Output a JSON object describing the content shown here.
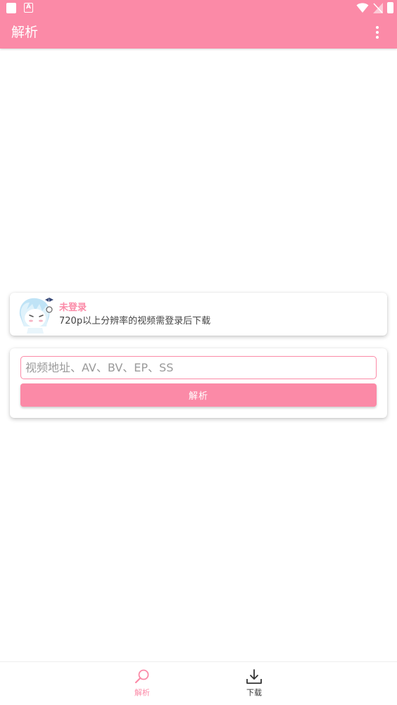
{
  "app": {
    "title": "解析",
    "accent_color": "#fb8aa7"
  },
  "status_bar": {
    "icons": [
      "sim-card-icon",
      "app-notification-icon",
      "wifi-icon",
      "signal-icon",
      "battery-icon"
    ]
  },
  "login_card": {
    "title": "未登录",
    "description": "720p以上分辨率的视频需登录后下载",
    "avatar_icon": "anime-avatar-icon"
  },
  "parse_form": {
    "input_value": "",
    "input_placeholder": "视频地址、AV、BV、EP、SS",
    "button_label": "解析"
  },
  "bottom_nav": {
    "items": [
      {
        "label": "解析",
        "icon": "search-icon",
        "active": true
      },
      {
        "label": "下载",
        "icon": "download-icon",
        "active": false
      }
    ]
  }
}
